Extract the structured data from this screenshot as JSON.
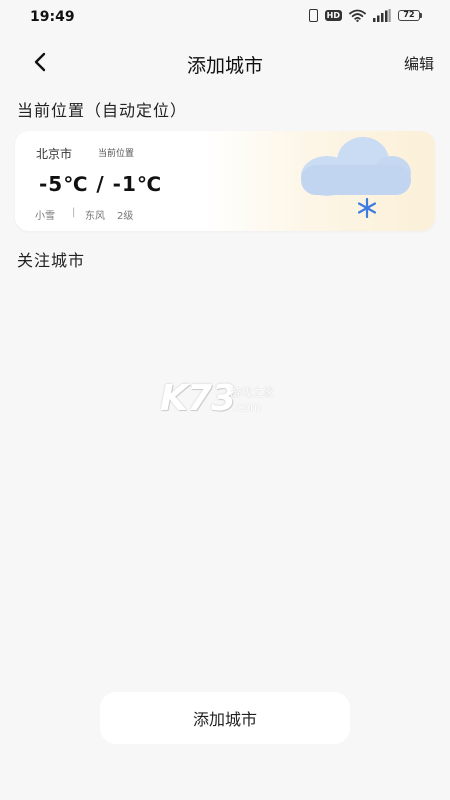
{
  "status_bar": {
    "time": "19:49",
    "network_badge": "HD",
    "battery": "72",
    "icons": [
      "vibrate-icon",
      "hd-icon",
      "wifi-icon",
      "signal-icon",
      "battery-icon"
    ]
  },
  "header": {
    "back_icon": "chevron-left-icon",
    "title": "添加城市",
    "edit_label": "编辑"
  },
  "current_location": {
    "section_title": "当前位置（自动定位）",
    "city": "北京市",
    "tag": "当前位置",
    "temperature": "-5℃  /  -1℃",
    "condition": "小雪",
    "separator": "|",
    "wind_direction": "东风",
    "wind_level": "2级",
    "weather_icon": "snow-cloud-icon"
  },
  "followed_section_title": "关注城市",
  "watermark": {
    "brand": "K73",
    "cn": "游戏之家",
    "domain": ".com"
  },
  "add_button_label": "添加城市",
  "colors": {
    "background": "#f7f7f7",
    "card": "#ffffff",
    "cloud": "#c2d7f2",
    "snowflake": "#3c7be0"
  }
}
